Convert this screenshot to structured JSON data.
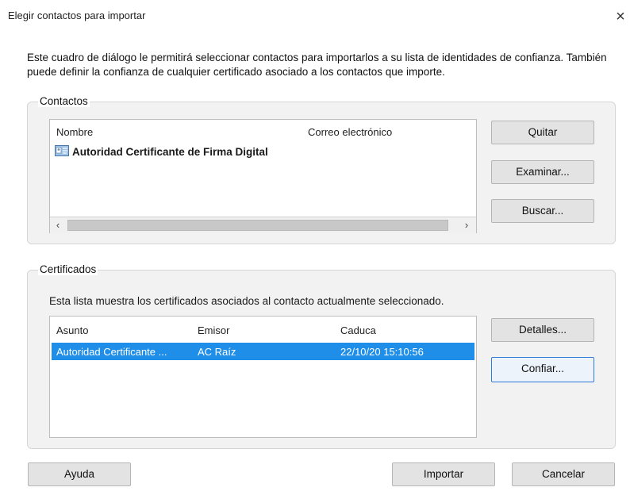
{
  "window": {
    "title": "Elegir contactos para importar",
    "close_glyph": "×"
  },
  "description": "Este cuadro de diálogo le permitirá seleccionar contactos para importarlos a su lista de identidades de confianza. También puede definir la confianza de cualquier certificado asociado a los contactos que importe.",
  "contacts": {
    "group_label": "Contactos",
    "columns": [
      "Nombre",
      "Correo electrónico"
    ],
    "rows": [
      {
        "nombre": "Autoridad Certificante de Firma Digital",
        "correo": "",
        "icon": "contact-card-icon"
      }
    ],
    "scroll_left_glyph": "‹",
    "scroll_right_glyph": "›",
    "buttons": {
      "quitar": "Quitar",
      "examinar": "Examinar...",
      "buscar": "Buscar..."
    }
  },
  "certificates": {
    "group_label": "Certificados",
    "hint": "Esta lista muestra los certificados asociados al contacto actualmente seleccionado.",
    "columns": [
      "Asunto",
      "Emisor",
      "Caduca"
    ],
    "rows": [
      {
        "asunto": "Autoridad Certificante ...",
        "emisor": "AC Raíz",
        "caduca": "22/10/20 15:10:56",
        "selected": true
      }
    ],
    "buttons": {
      "detalles": "Detalles...",
      "confiar": "Confiar..."
    }
  },
  "footer": {
    "ayuda": "Ayuda",
    "importar": "Importar",
    "cancelar": "Cancelar"
  },
  "colors": {
    "selection": "#1f8ee8",
    "focus_border": "#2f7cd6"
  }
}
